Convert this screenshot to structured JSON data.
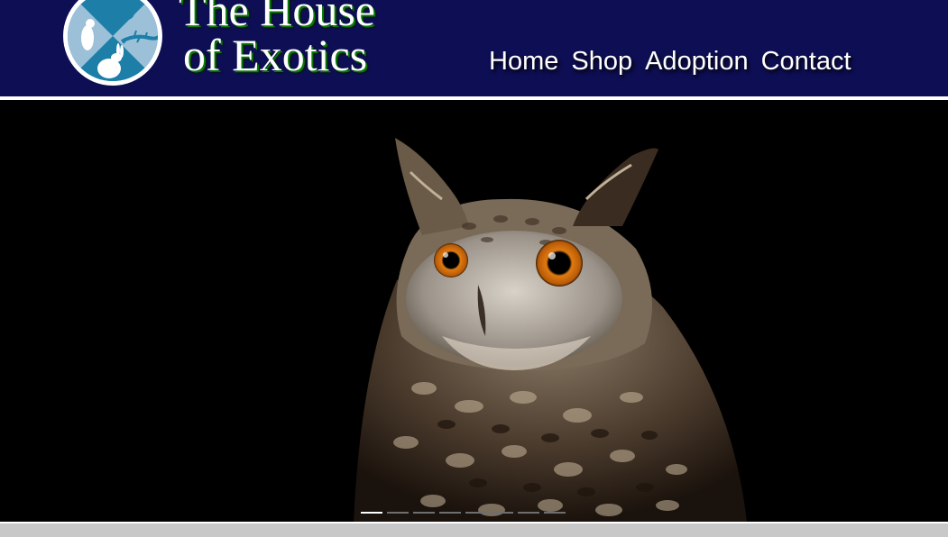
{
  "brand": {
    "line1": "The House",
    "line2": "of Exotics"
  },
  "logo": {
    "icon": "pet-silhouettes-logo",
    "colors": {
      "blue": "#1d7fa8",
      "light": "#9cc0d8",
      "ring": "#ffffff"
    }
  },
  "nav": {
    "items": [
      {
        "label": "Home"
      },
      {
        "label": "Shop"
      },
      {
        "label": "Adoption"
      },
      {
        "label": "Contact"
      }
    ]
  },
  "hero": {
    "subject": "owl-photo",
    "slides_total": 8,
    "active_slide": 1
  },
  "colors": {
    "header_bg": "#0e0e55",
    "brand_shadow": "#0a7a0a",
    "footer_bar": "#c8c8c8"
  }
}
